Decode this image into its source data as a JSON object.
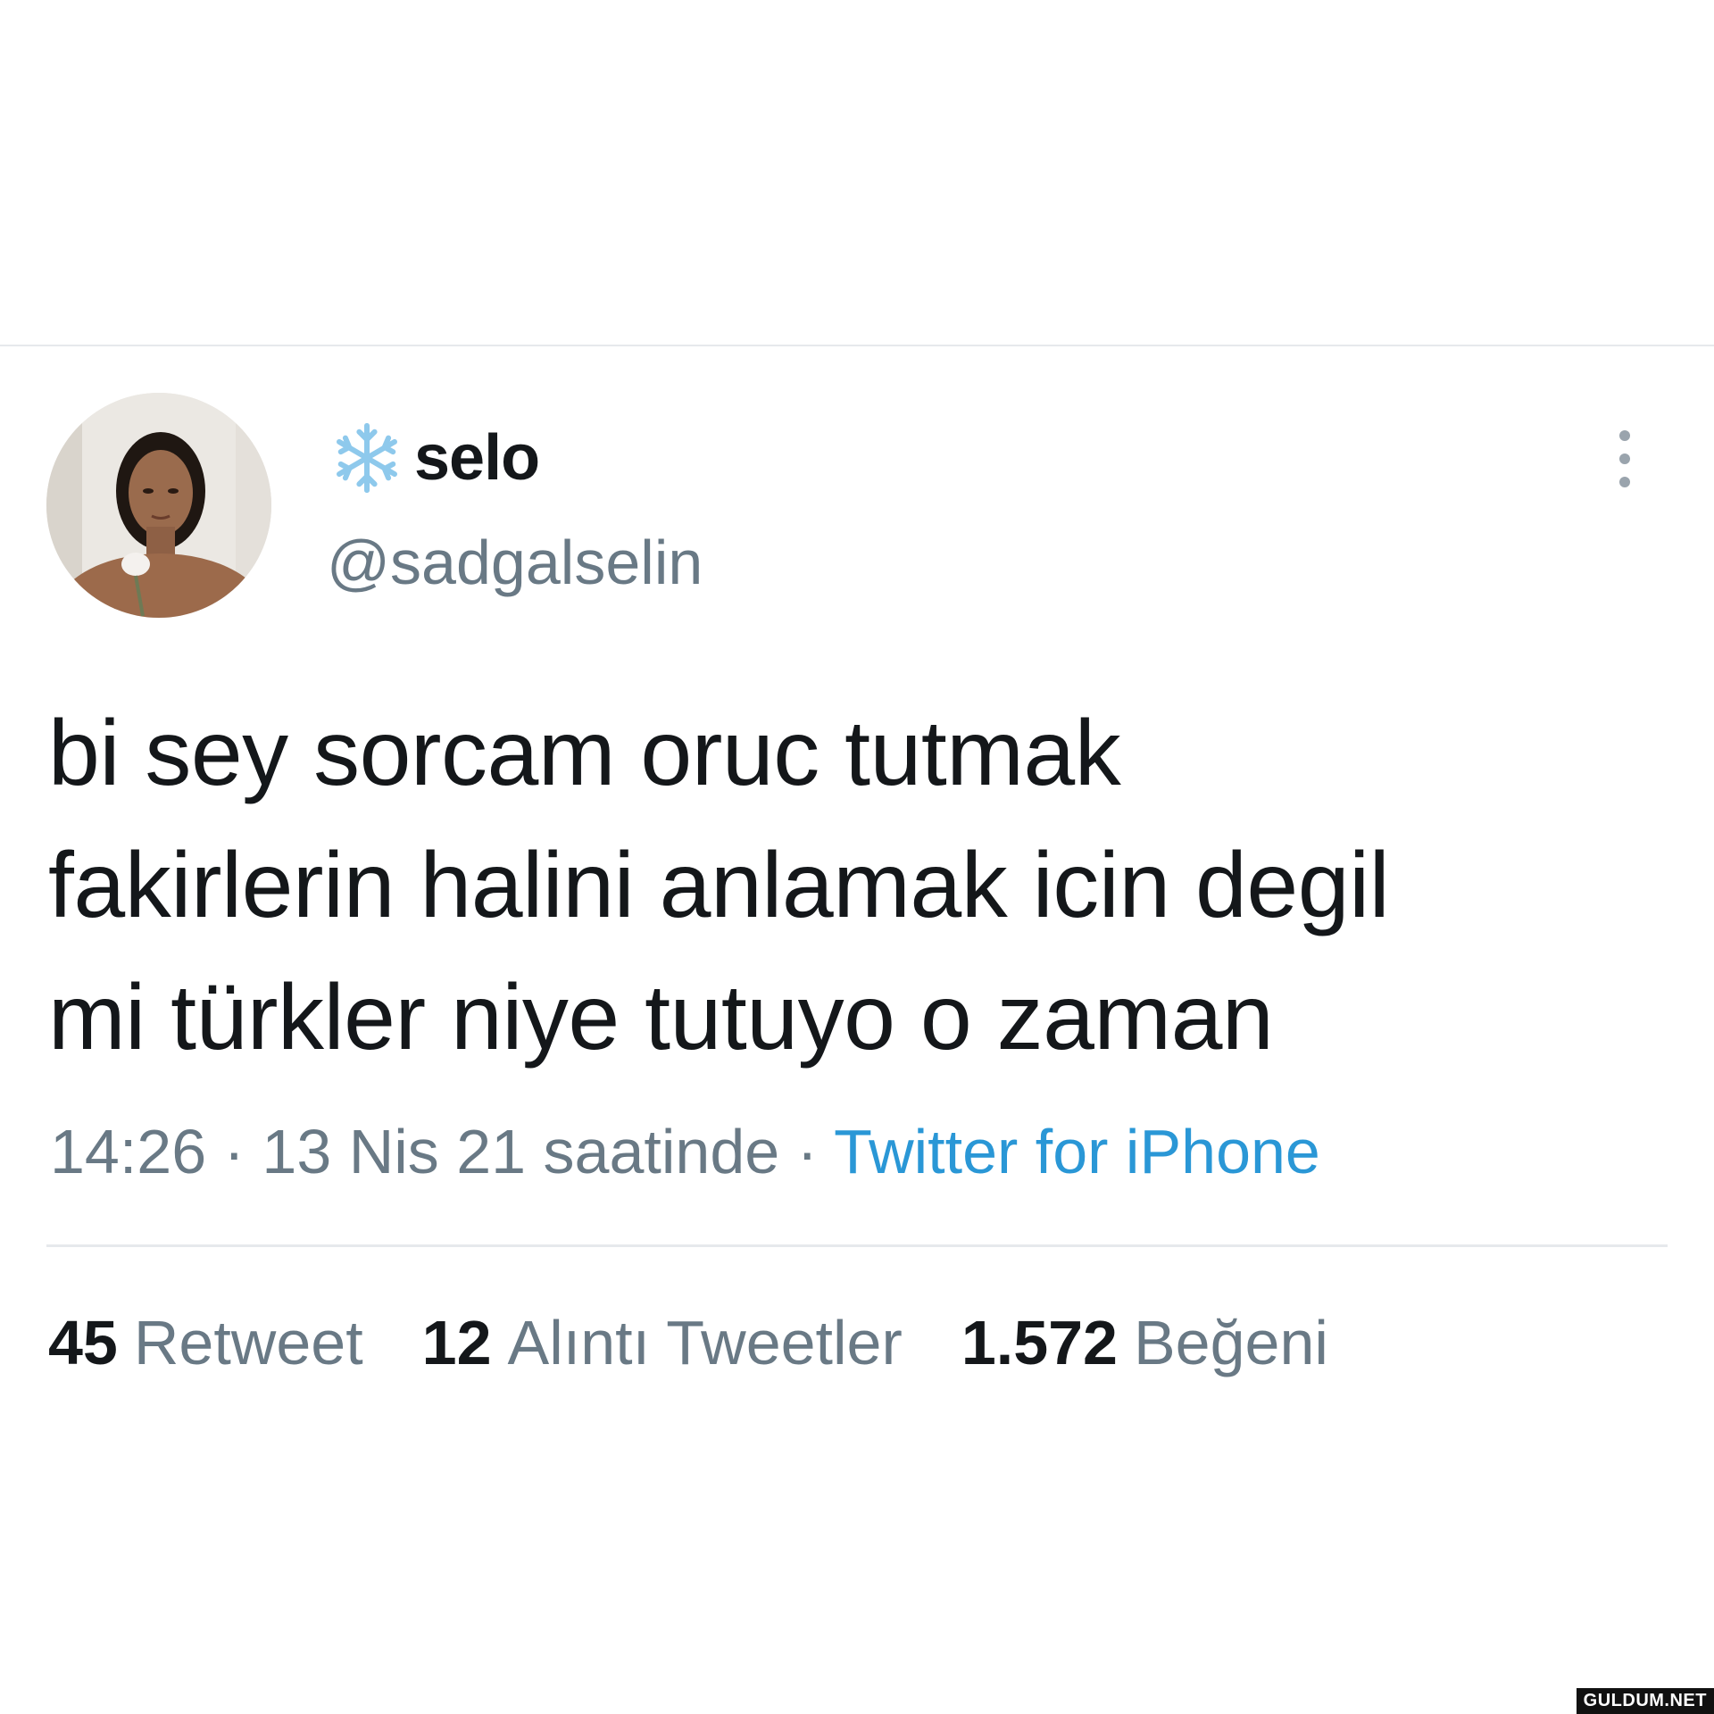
{
  "tweet": {
    "author": {
      "display_name": "selo",
      "handle": "@sadgalselin",
      "name_emoji_icon": "snowflake-icon",
      "avatar_icon": "profile-photo"
    },
    "more_icon": "vertical-ellipsis-icon",
    "text_lines": [
      "bi sey sorcam oruc tutmak",
      "fakirlerin halini anlamak icin degil",
      "mi türkler niye tutuyo o zaman"
    ],
    "meta": {
      "time": "14:26",
      "separator1": " · ",
      "date": "13 Nis 21 saatinde",
      "separator2": " · ",
      "source": "Twitter for iPhone"
    },
    "stats": {
      "retweets": {
        "count": "45",
        "label": "Retweet"
      },
      "quotes": {
        "count": "12",
        "label": "Alıntı Tweetler"
      },
      "likes": {
        "count": "1.572",
        "label": "Beğeni"
      }
    }
  },
  "watermark": "GULDUM.NET",
  "colors": {
    "text_primary": "#14171a",
    "text_secondary": "#697985",
    "link": "#2a97d6",
    "divider": "#e6e9ec",
    "snowflake": "#8ec9ec"
  }
}
